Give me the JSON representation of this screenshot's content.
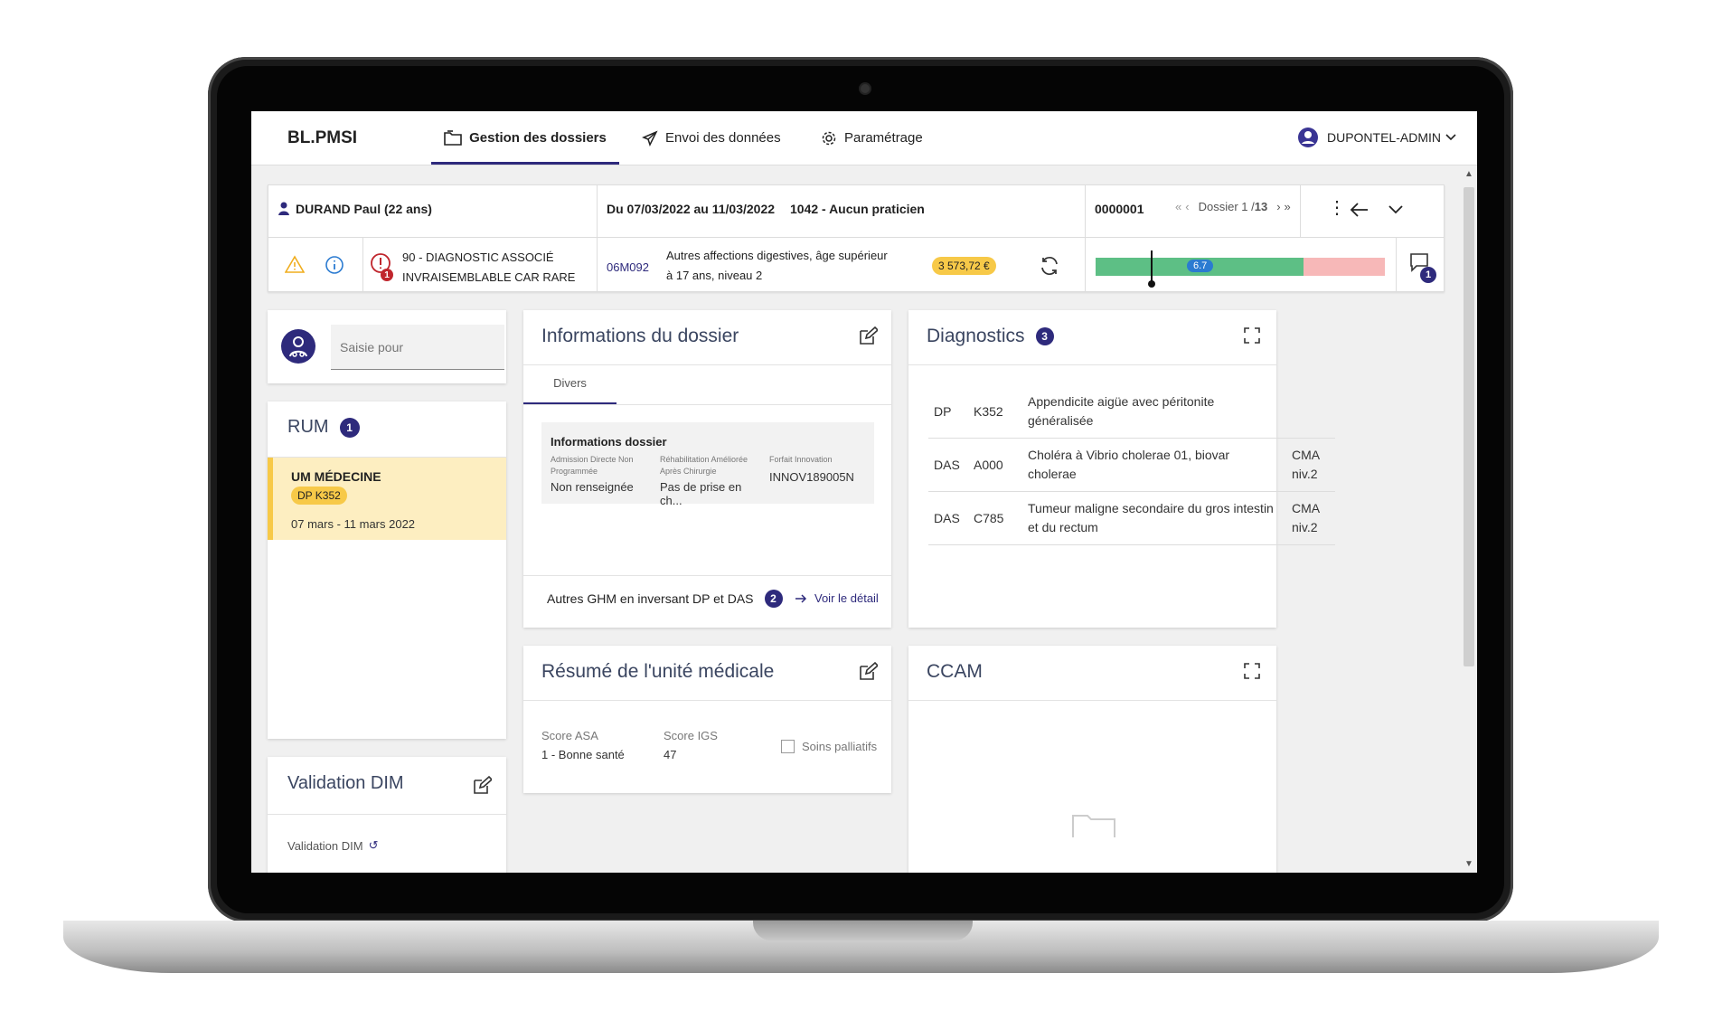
{
  "app": {
    "brand": "BL.PMSI"
  },
  "nav": {
    "tabs": [
      {
        "label": "Gestion des dossiers",
        "icon": "folder-icon",
        "active": true
      },
      {
        "label": "Envoi des données",
        "icon": "send-icon",
        "active": false
      },
      {
        "label": "Paramétrage",
        "icon": "gear-icon",
        "active": false
      }
    ],
    "user": "DUPONTEL-ADMIN"
  },
  "patient": {
    "name": "DURAND Paul (22 ans)",
    "dates": "Du 07/03/2022 au 11/03/2022",
    "practitioner": "1042 - Aucun praticien",
    "dossier_id": "0000001",
    "dossier_label": "Dossier 1 / ",
    "dossier_total": "13"
  },
  "alerts": {
    "error_count": "1",
    "error_text_1": "90 - DIAGNOSTIC ASSOCIÉ",
    "error_text_2": "INVRAISEMBLABLE CAR RARE",
    "ghm_code": "06M092",
    "ghm_text_1": "Autres affections digestives, âge supérieur",
    "ghm_text_2": "à 17 ans, niveau 2",
    "amount": "3 573,72 €",
    "score": "6.7",
    "score_fraction": 0.19,
    "comments_count": "1",
    "colors": {
      "green": "#5dbf85",
      "red": "#f7b8b8",
      "accent": "#2e2a7c",
      "warning": "#f0ad1e",
      "error": "#c0262d"
    }
  },
  "saisie": {
    "placeholder": "Saisie pour"
  },
  "rum": {
    "title": "RUM",
    "count": "1",
    "unit": "UM MÉDECINE",
    "dp": "DP K352",
    "period": "07 mars - 11 mars 2022"
  },
  "validation": {
    "title": "Validation DIM",
    "label": "Validation DIM"
  },
  "informations": {
    "title": "Informations du dossier",
    "tab": "Divers",
    "box_title": "Informations dossier",
    "fields": [
      {
        "label": "Admission Directe Non Programmée",
        "value": "Non renseignée"
      },
      {
        "label": "Réhabilitation Améliorée Après Chirurgie",
        "value": "Pas de prise en ch..."
      },
      {
        "label": "Forfait Innovation",
        "value": "INNOV189005N"
      }
    ],
    "other_ghm": "Autres GHM en inversant DP et DAS",
    "other_ghm_count": "2",
    "detail_link": "Voir le détail"
  },
  "diagnostics": {
    "title": "Diagnostics",
    "count": "3",
    "rows": [
      {
        "type": "DP",
        "code": "K352",
        "label": "Appendicite aigüe avec péritonite généralisée",
        "level": ""
      },
      {
        "type": "DAS",
        "code": "A000",
        "label": "Choléra à Vibrio cholerae 01, biovar cholerae",
        "level": "CMA niv.2"
      },
      {
        "type": "DAS",
        "code": "C785",
        "label": "Tumeur maligne secondaire du gros intestin et du rectum",
        "level": "CMA niv.2"
      }
    ]
  },
  "resume": {
    "title": "Résumé de l'unité médicale",
    "asa_label": "Score ASA",
    "asa_value": "1 - Bonne santé",
    "igs_label": "Score IGS",
    "igs_value": "47",
    "palliatifs": "Soins palliatifs"
  },
  "ccam": {
    "title": "CCAM"
  }
}
